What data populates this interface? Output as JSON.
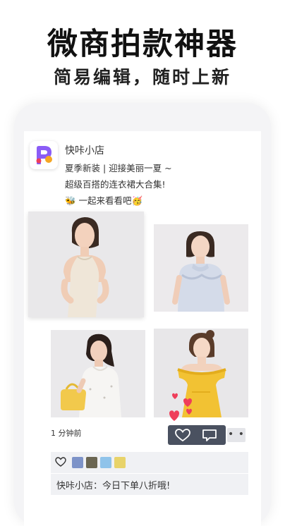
{
  "promo": {
    "headline": "微商拍款神器",
    "subheadline": "简易编辑，随时上新"
  },
  "post": {
    "shop_name": "快咔小店",
    "lines": [
      "夏季新装 | 迎接美丽一夏 ~",
      "超级百搭的连衣裙大合集!",
      "🐝 一起来看看吧🥳"
    ],
    "photos": [
      "woman-white-halter-top",
      "woman-blue-ruffle-blouse",
      "woman-white-dress-yellow-bag",
      "woman-yellow-offshoulder-dress"
    ],
    "time_ago": "1 分钟前",
    "actions": {
      "like_icon": "heart-outline-icon",
      "comment_icon": "comment-icon",
      "more_label": "• •"
    },
    "comment": "快咔小店：今日下单八折哦!"
  },
  "colors": {
    "action_bar": "#4a5160",
    "heart_red": "#ef3e5a",
    "interaction_bg": "#f0f1f4"
  }
}
